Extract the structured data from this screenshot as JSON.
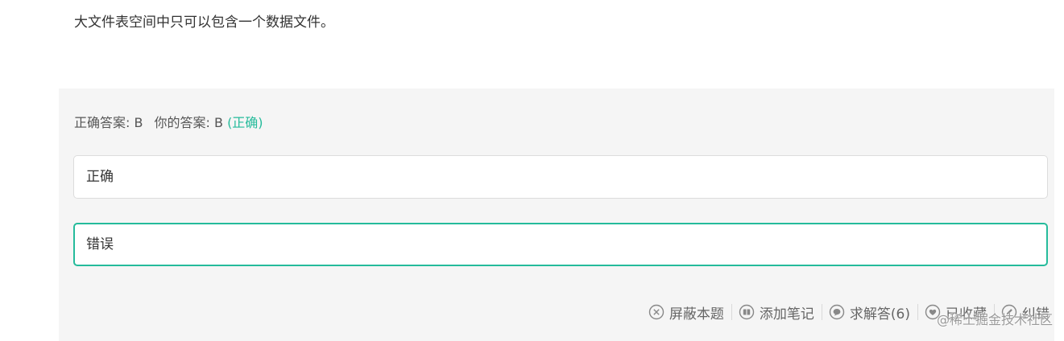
{
  "question": {
    "text": "大文件表空间中只可以包含一个数据文件。"
  },
  "answer": {
    "correct_label": "正确答案:",
    "correct_value": "B",
    "yours_label": "你的答案:",
    "yours_value": "B",
    "result": "(正确)"
  },
  "options": [
    {
      "label": "正确",
      "selected": false
    },
    {
      "label": "错误",
      "selected": true
    }
  ],
  "toolbar": {
    "hide": "屏蔽本题",
    "note": "添加笔记",
    "ask": "求解答(6)",
    "collect": "已收藏",
    "report": "纠错"
  },
  "watermark": "@稀土掘金技术社区",
  "colors": {
    "accent": "#25bb9b",
    "panel_bg": "#f5f5f5",
    "text": "#333333",
    "muted": "#666666"
  }
}
